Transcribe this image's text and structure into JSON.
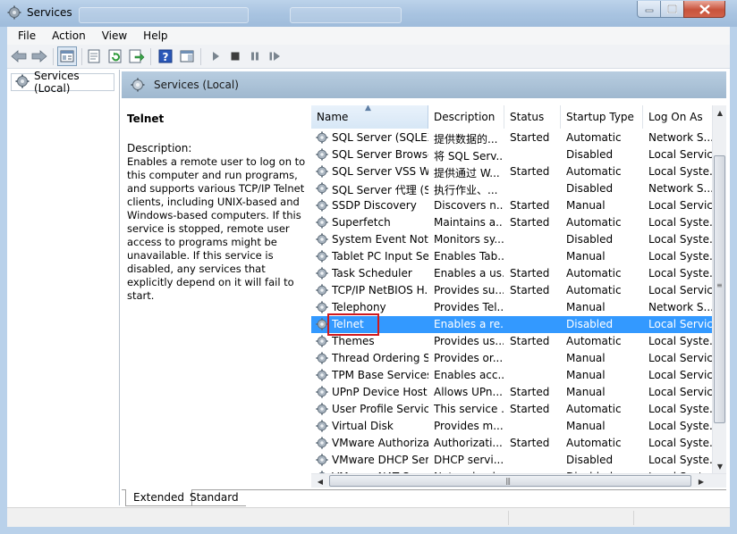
{
  "window": {
    "title": "Services"
  },
  "menu": [
    "File",
    "Action",
    "View",
    "Help"
  ],
  "toolbar": {
    "icons": [
      "back-arrow-icon",
      "forward-arrow-icon",
      "console-tree-icon",
      "properties-icon",
      "refresh-icon",
      "export-list-icon",
      "help-icon",
      "show-hide-action-pane-icon",
      "play-icon",
      "stop-icon",
      "pause-icon",
      "restart-icon"
    ]
  },
  "tree": {
    "root_label": "Services (Local)"
  },
  "panel": {
    "title": "Services (Local)"
  },
  "details": {
    "service_name": "Telnet",
    "description_label": "Description:",
    "description_text": "Enables a remote user to log on to this computer and run programs, and supports various TCP/IP Telnet clients, including UNIX-based and Windows-based computers. If this service is stopped, remote user access to programs might be unavailable. If this service is disabled, any services that explicitly depend on it will fail to start."
  },
  "table": {
    "columns": [
      "Name",
      "Description",
      "Status",
      "Startup Type",
      "Log On As"
    ],
    "sorted_column": "Name",
    "selected_row": "Telnet",
    "rows": [
      {
        "name": "SQL Server (SQLEX...",
        "description": "提供数据的...",
        "status": "Started",
        "startup": "Automatic",
        "logon": "Network S..."
      },
      {
        "name": "SQL Server Browser",
        "description": "将 SQL Serv...",
        "status": "",
        "startup": "Disabled",
        "logon": "Local Service"
      },
      {
        "name": "SQL Server VSS Wr...",
        "description": "提供通过 W...",
        "status": "Started",
        "startup": "Automatic",
        "logon": "Local Syste..."
      },
      {
        "name": "SQL Server 代理 (S...",
        "description": "执行作业、...",
        "status": "",
        "startup": "Disabled",
        "logon": "Network S..."
      },
      {
        "name": "SSDP Discovery",
        "description": "Discovers n...",
        "status": "Started",
        "startup": "Manual",
        "logon": "Local Service"
      },
      {
        "name": "Superfetch",
        "description": "Maintains a...",
        "status": "Started",
        "startup": "Automatic",
        "logon": "Local Syste..."
      },
      {
        "name": "System Event Noti...",
        "description": "Monitors sy...",
        "status": "",
        "startup": "Disabled",
        "logon": "Local Syste..."
      },
      {
        "name": "Tablet PC Input Se...",
        "description": "Enables Tab...",
        "status": "",
        "startup": "Manual",
        "logon": "Local Syste..."
      },
      {
        "name": "Task Scheduler",
        "description": "Enables a us...",
        "status": "Started",
        "startup": "Automatic",
        "logon": "Local Syste..."
      },
      {
        "name": "TCP/IP NetBIOS H...",
        "description": "Provides su...",
        "status": "Started",
        "startup": "Automatic",
        "logon": "Local Service"
      },
      {
        "name": "Telephony",
        "description": "Provides Tel...",
        "status": "",
        "startup": "Manual",
        "logon": "Network S..."
      },
      {
        "name": "Telnet",
        "description": "Enables a re...",
        "status": "",
        "startup": "Disabled",
        "logon": "Local Service"
      },
      {
        "name": "Themes",
        "description": "Provides us...",
        "status": "Started",
        "startup": "Automatic",
        "logon": "Local Syste..."
      },
      {
        "name": "Thread Ordering S...",
        "description": "Provides or...",
        "status": "",
        "startup": "Manual",
        "logon": "Local Service"
      },
      {
        "name": "TPM Base Services",
        "description": "Enables acc...",
        "status": "",
        "startup": "Manual",
        "logon": "Local Service"
      },
      {
        "name": "UPnP Device Host",
        "description": "Allows UPn...",
        "status": "Started",
        "startup": "Manual",
        "logon": "Local Service"
      },
      {
        "name": "User Profile Service",
        "description": "This service ...",
        "status": "Started",
        "startup": "Automatic",
        "logon": "Local Syste..."
      },
      {
        "name": "Virtual Disk",
        "description": "Provides m...",
        "status": "",
        "startup": "Manual",
        "logon": "Local Syste..."
      },
      {
        "name": "VMware Authoriza...",
        "description": "Authorizati...",
        "status": "Started",
        "startup": "Automatic",
        "logon": "Local Syste..."
      },
      {
        "name": "VMware DHCP Ser...",
        "description": "DHCP servi...",
        "status": "",
        "startup": "Disabled",
        "logon": "Local Syste..."
      },
      {
        "name": "VMware NAT Se...",
        "description": "Network ad...",
        "status": "",
        "startup": "Disabled",
        "logon": "Local Syste..."
      }
    ]
  },
  "tabs": [
    "Extended",
    "Standard"
  ],
  "active_tab": "Extended",
  "colors": {
    "selection": "#3399ff",
    "highlight_box": "#d0191d",
    "header_band": "#a9c1d8"
  }
}
